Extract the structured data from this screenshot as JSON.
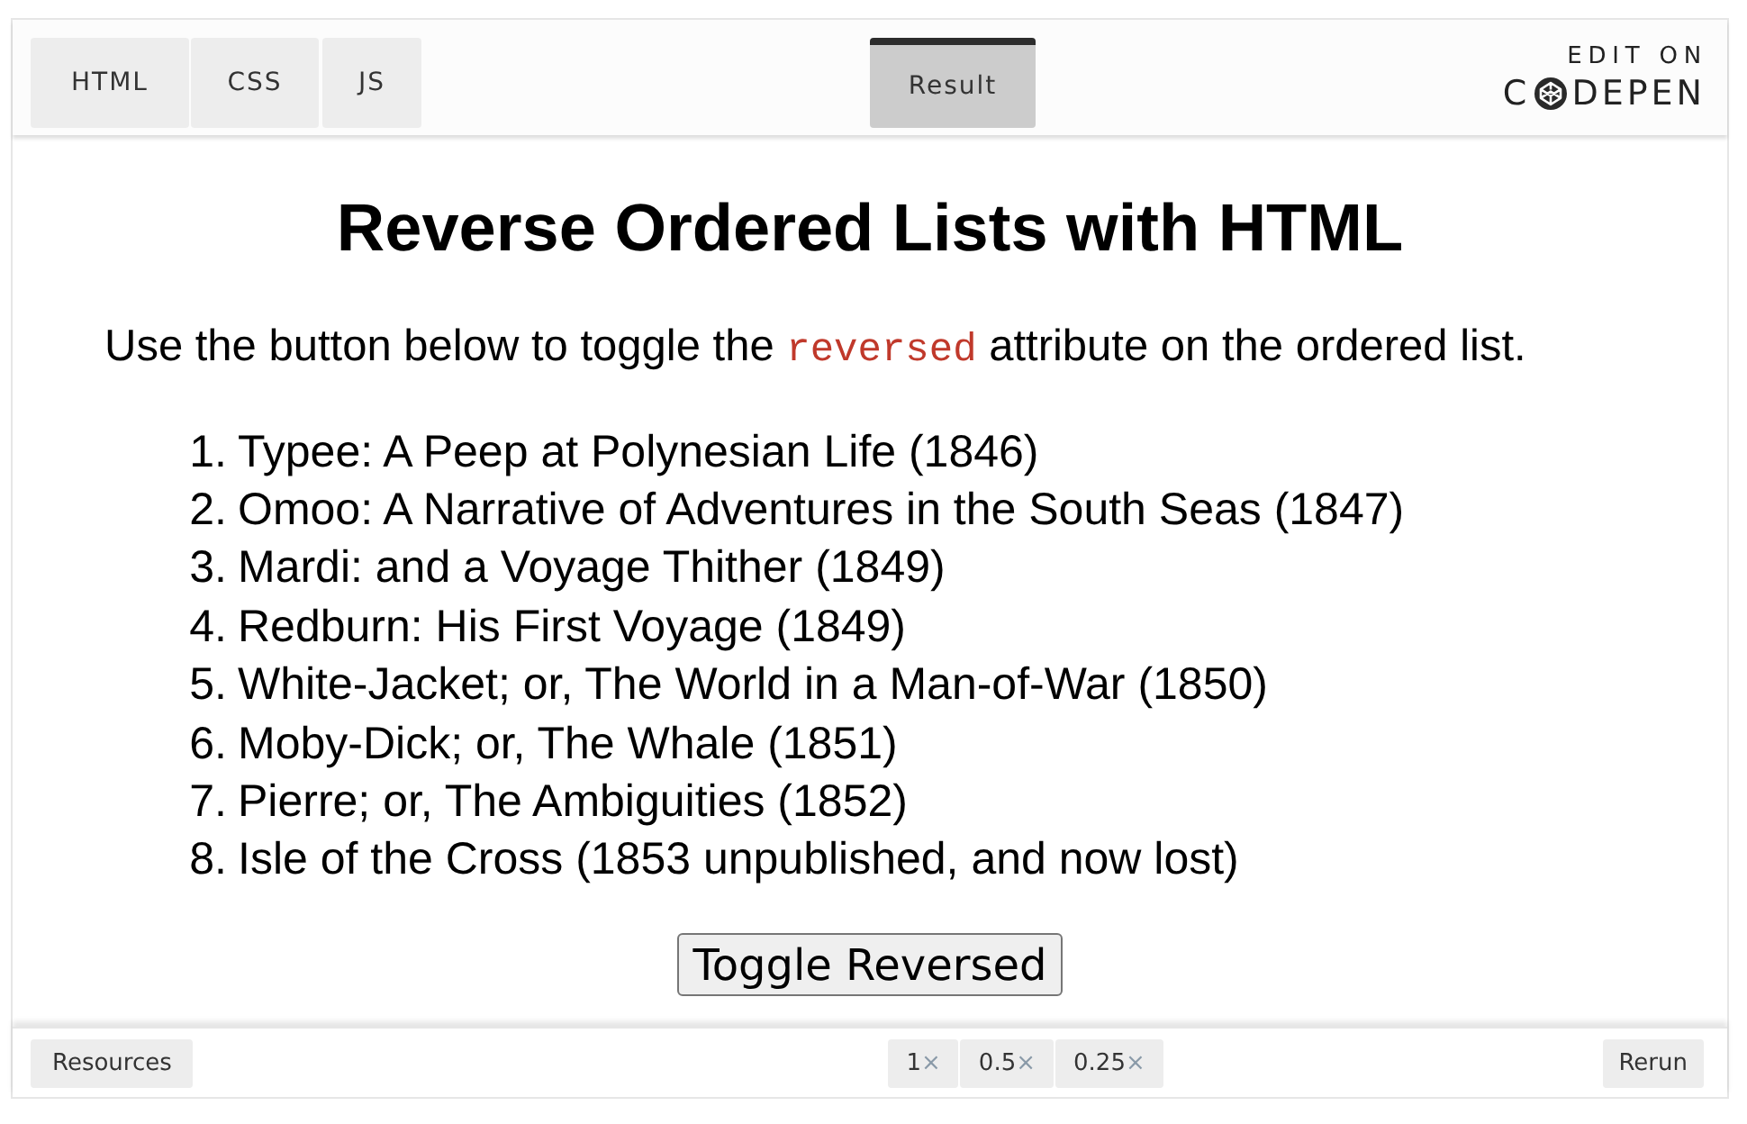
{
  "editor_tabs": [
    {
      "label": "HTML",
      "selected": false
    },
    {
      "label": "CSS",
      "selected": false
    },
    {
      "label": "JS",
      "selected": false
    }
  ],
  "result_tab": {
    "label": "Result",
    "selected": true
  },
  "edit_link": {
    "caption": "EDIT ON",
    "logo_start": "C",
    "logo_end": "DEPEN"
  },
  "result": {
    "title": "Reverse Ordered Lists with HTML",
    "intro": [
      {
        "kind": "text",
        "text": "Use the button below to toggle the "
      },
      {
        "kind": "code",
        "text": "reversed"
      },
      {
        "kind": "text",
        "text": " attribute on the ordered list."
      }
    ],
    "list": [
      {
        "number": "1.",
        "text": "Typee: A Peep at Polynesian Life (1846)"
      },
      {
        "number": "2.",
        "text": "Omoo: A Narrative of Adventures in the South Seas (1847)"
      },
      {
        "number": "3.",
        "text": "Mardi: and a Voyage Thither (1849)"
      },
      {
        "number": "4.",
        "text": "Redburn: His First Voyage (1849)"
      },
      {
        "number": "5.",
        "text": "White-Jacket; or, The World in a Man-of-War (1850)"
      },
      {
        "number": "6.",
        "text": "Moby-Dick; or, The Whale (1851)"
      },
      {
        "number": "7.",
        "text": "Pierre; or, The Ambiguities (1852)"
      },
      {
        "number": "8.",
        "text": "Isle of the Cross (1853 unpublished, and now lost)"
      }
    ],
    "button": "Toggle Reversed"
  },
  "footer": {
    "resources": "Resources",
    "zoom_options": [
      {
        "label": "1",
        "suffix": "×"
      },
      {
        "label": "0.5",
        "suffix": "×"
      },
      {
        "label": "0.25",
        "suffix": "×"
      }
    ],
    "rerun": "Rerun"
  }
}
